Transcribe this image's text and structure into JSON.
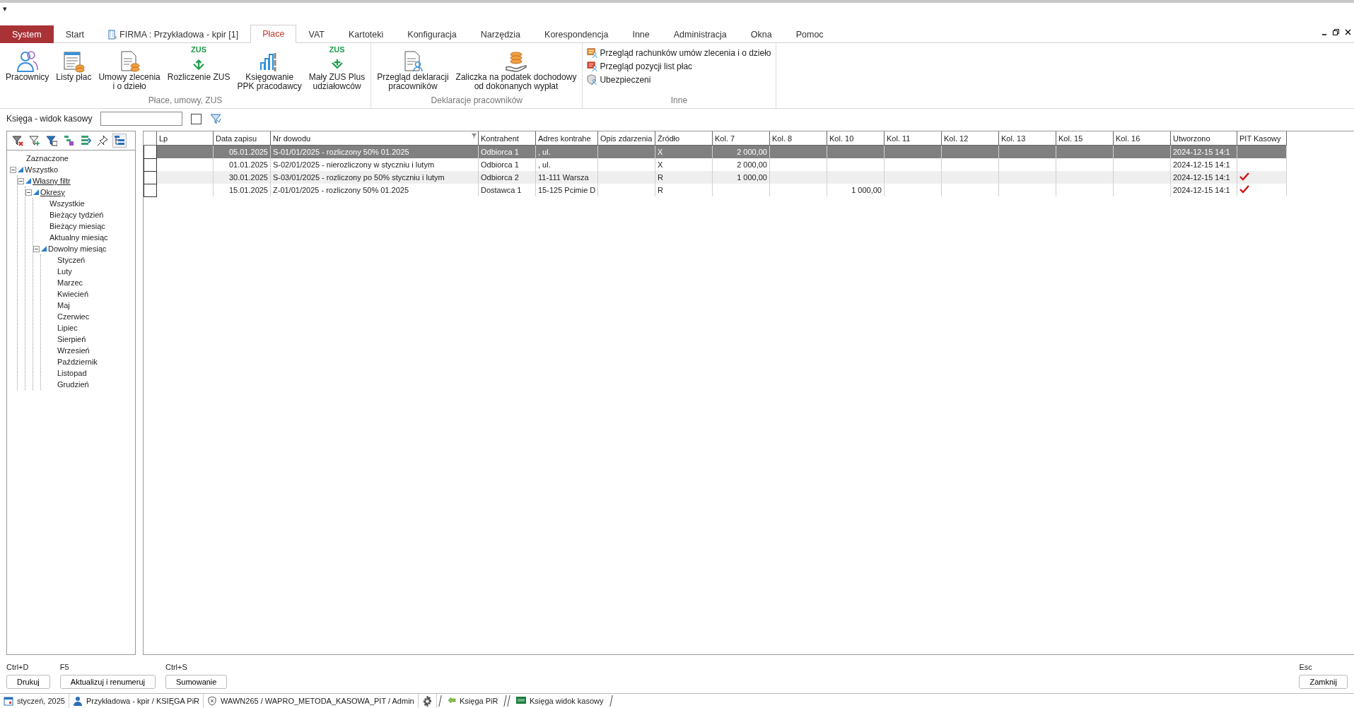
{
  "quick_access": "▾",
  "tabs": [
    {
      "label": "System",
      "kind": "system",
      "selected": false
    },
    {
      "label": "Start",
      "kind": "tab",
      "selected": false
    },
    {
      "label": "FIRMA : Przykładowa - kpir [1]",
      "kind": "company",
      "selected": false
    },
    {
      "label": "Płace",
      "kind": "tab",
      "selected": true
    },
    {
      "label": "VAT",
      "kind": "tab",
      "selected": false
    },
    {
      "label": "Kartoteki",
      "kind": "tab",
      "selected": false
    },
    {
      "label": "Konfiguracja",
      "kind": "tab",
      "selected": false
    },
    {
      "label": "Narzędzia",
      "kind": "tab",
      "selected": false
    },
    {
      "label": "Korespondencja",
      "kind": "tab",
      "selected": false
    },
    {
      "label": "Inne",
      "kind": "tab",
      "selected": false
    },
    {
      "label": "Administracja",
      "kind": "tab",
      "selected": false
    },
    {
      "label": "Okna",
      "kind": "tab",
      "selected": false
    },
    {
      "label": "Pomoc",
      "kind": "tab",
      "selected": false
    }
  ],
  "ribbon": [
    {
      "label": "Płace, umowy, ZUS",
      "kind": "large",
      "buttons": [
        {
          "label": "Pracownicy"
        },
        {
          "label": "Listy płac"
        },
        {
          "label": "Umowy zlecenia\ni o dzieło"
        },
        {
          "label": "Rozliczenie ZUS",
          "icon_text": "ZUS"
        },
        {
          "label": "Księgowanie\nPPK pracodawcy"
        },
        {
          "label": "Mały ZUS Plus\nudziałowców",
          "icon_text": "ZUS"
        }
      ]
    },
    {
      "label": "Deklaracje pracowników",
      "kind": "large",
      "buttons": [
        {
          "label": "Przegląd deklaracji\npracowników"
        },
        {
          "label": "Zaliczka na podatek dochodowy\nod dokonanych wypłat"
        }
      ]
    },
    {
      "label": "Inne",
      "kind": "small",
      "buttons": [
        {
          "label": "Przegląd rachunków umów zlecenia i o dzieło"
        },
        {
          "label": "Przegląd pozycji list płac"
        },
        {
          "label": "Ubezpieczeni"
        }
      ]
    }
  ],
  "filter_bar": {
    "label": "Księga - widok kasowy",
    "checked": false
  },
  "tree_toolbar": [
    {
      "selected": false
    },
    {
      "selected": false
    },
    {
      "selected": false
    },
    {
      "selected": false
    },
    {
      "selected": false
    },
    {
      "selected": false
    },
    {
      "selected": true
    }
  ],
  "tree": [
    {
      "label": "Zaznaczone",
      "underlined": false
    },
    {
      "label": "Wszystko",
      "underlined": false,
      "expanded": true,
      "children": [
        {
          "label": "Własny filtr",
          "underlined": true,
          "expanded": true,
          "children": [
            {
              "label": "Okresy",
              "underlined": true,
              "expanded": true,
              "children": [
                {
                  "label": "Wszystkie",
                  "underlined": false
                },
                {
                  "label": "Bieżący tydzień",
                  "underlined": false
                },
                {
                  "label": "Bieżący miesiąc",
                  "underlined": false
                },
                {
                  "label": "Aktualny miesiąc",
                  "underlined": false
                },
                {
                  "label": "Dowolny miesiąc",
                  "underlined": false,
                  "expanded": true,
                  "children": [
                    {
                      "label": "Styczeń",
                      "underlined": false
                    },
                    {
                      "label": "Luty",
                      "underlined": false
                    },
                    {
                      "label": "Marzec",
                      "underlined": false
                    },
                    {
                      "label": "Kwiecień",
                      "underlined": false
                    },
                    {
                      "label": "Maj",
                      "underlined": false
                    },
                    {
                      "label": "Czerwiec",
                      "underlined": false
                    },
                    {
                      "label": "Lipiec",
                      "underlined": false
                    },
                    {
                      "label": "Sierpień",
                      "underlined": false
                    },
                    {
                      "label": "Wrzesień",
                      "underlined": false
                    },
                    {
                      "label": "Październik",
                      "underlined": false
                    },
                    {
                      "label": "Listopad",
                      "underlined": false
                    },
                    {
                      "label": "Grudzień",
                      "underlined": false
                    }
                  ]
                }
              ]
            }
          ]
        }
      ]
    }
  ],
  "table": {
    "columns": [
      {
        "label": "Lp",
        "filtered": false
      },
      {
        "label": "Data zapisu",
        "filtered": false
      },
      {
        "label": "Nr dowodu",
        "filtered": true
      },
      {
        "label": "Kontrahent",
        "filtered": false
      },
      {
        "label": "Adres kontrahe",
        "filtered": false
      },
      {
        "label": "Opis zdarzenia",
        "filtered": false
      },
      {
        "label": "Źródło",
        "filtered": false
      },
      {
        "label": "Kol. 7",
        "filtered": false
      },
      {
        "label": "Kol. 8",
        "filtered": false
      },
      {
        "label": "Kol. 10",
        "filtered": false
      },
      {
        "label": "Kol. 11",
        "filtered": false
      },
      {
        "label": "Kol. 12",
        "filtered": false
      },
      {
        "label": "Kol. 13",
        "filtered": false
      },
      {
        "label": "Kol. 15",
        "filtered": false
      },
      {
        "label": "Kol. 16",
        "filtered": false
      },
      {
        "label": "Utworzono",
        "filtered": false
      },
      {
        "label": "PIT Kasowy",
        "filtered": false
      }
    ],
    "rows": [
      {
        "selected": true,
        "pit_kasowy": false,
        "cells": [
          null,
          "05.01.2025",
          "S-01/01/2025 - rozliczony 50% 01.2025",
          "Odbiorca 1",
          ", ul.",
          null,
          "X",
          "2 000,00",
          null,
          null,
          null,
          null,
          null,
          null,
          null,
          "2024-12-15 14:1"
        ]
      },
      {
        "selected": false,
        "pit_kasowy": false,
        "cells": [
          null,
          "01.01.2025",
          "S-02/01/2025 - nierozliczony w styczniu i lutym",
          "Odbiorca 1",
          ", ul.",
          null,
          "X",
          "2 000,00",
          null,
          null,
          null,
          null,
          null,
          null,
          null,
          "2024-12-15 14:1"
        ]
      },
      {
        "selected": false,
        "pit_kasowy": true,
        "cells": [
          null,
          "30.01.2025",
          "S-03/01/2025 - rozliczony po 50% styczniu i lutym",
          "Odbiorca 2",
          "11-111 Warsza",
          null,
          "R",
          "1 000,00",
          null,
          null,
          null,
          null,
          null,
          null,
          null,
          "2024-12-15 14:1"
        ]
      },
      {
        "selected": false,
        "pit_kasowy": true,
        "cells": [
          null,
          "15.01.2025",
          "Z-01/01/2025 - rozliczony 50% 01.2025",
          "Dostawca 1",
          "15-125 Pcimie D",
          null,
          "R",
          null,
          null,
          "1 000,00",
          null,
          null,
          null,
          null,
          null,
          "2024-12-15 14:1"
        ]
      }
    ]
  },
  "actions": [
    {
      "shortcut": "Ctrl+D",
      "label": "Drukuj",
      "kind": "left"
    },
    {
      "shortcut": "F5",
      "label": "Aktualizuj i renumeruj",
      "kind": "left"
    },
    {
      "shortcut": "Ctrl+S",
      "label": "Sumowanie",
      "kind": "left"
    },
    {
      "shortcut": "Esc",
      "label": "Zamknij",
      "kind": "right"
    }
  ],
  "status_bar": {
    "items": [
      {
        "text": "styczeń, 2025",
        "kind": "calendar"
      },
      {
        "text": "Przykładowa - kpir / KSIĘGA PiR",
        "kind": "user"
      },
      {
        "text": "WAWN265 / WAPRO_METODA_KASOWA_PIT / Admin",
        "kind": "database"
      },
      {
        "kind": "settings"
      }
    ],
    "tabs": [
      {
        "label": "Księga PiR",
        "kind": "arrow"
      },
      {
        "label": "Księga widok kasowy",
        "kind": "vat"
      }
    ]
  }
}
